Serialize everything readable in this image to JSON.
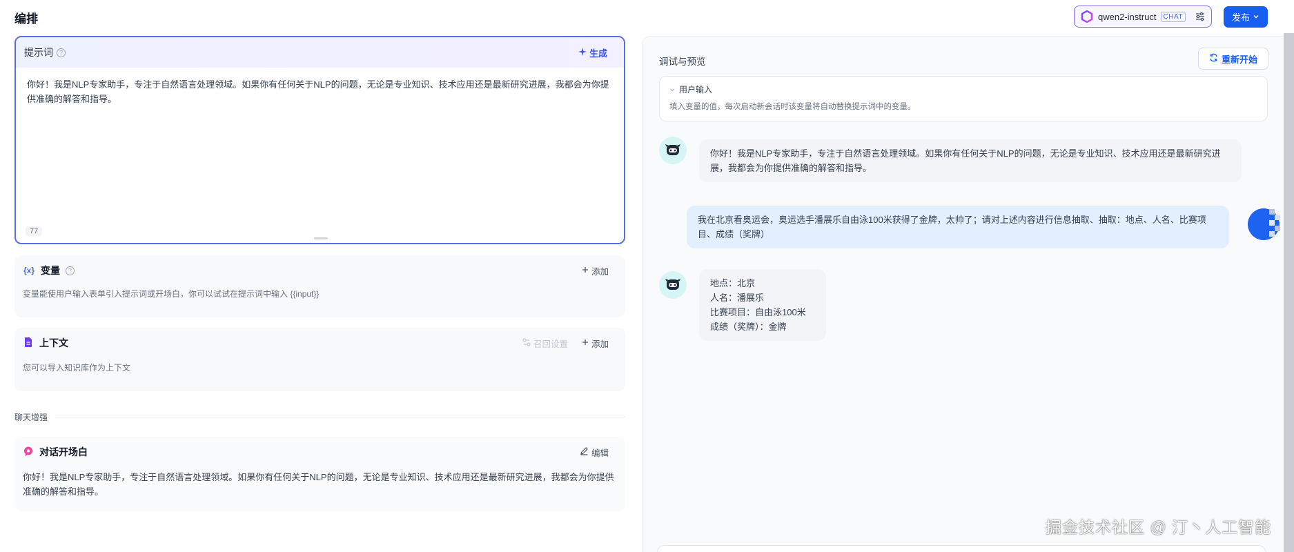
{
  "header": {
    "page_title": "编排",
    "model_name": "qwen2-instruct",
    "model_badge": "CHAT",
    "publish_label": "发布"
  },
  "prompt": {
    "title": "提示词",
    "generate_label": "生成",
    "text": "你好！我是NLP专家助手，专注于自然语言处理领域。如果你有任何关于NLP的问题，无论是专业知识、技术应用还是最新研究进展，我都会为你提供准确的解答和指导。",
    "char_count": "77"
  },
  "variables": {
    "title": "变量",
    "add_label": "添加",
    "description": "变量能使用户输入表单引入提示词或开场白，你可以试试在提示词中输入 {{input}}"
  },
  "context": {
    "title": "上下文",
    "recall_label": "召回设置",
    "add_label": "添加",
    "description": "您可以导入知识库作为上下文"
  },
  "chat_enhance": {
    "section_label": "聊天增强",
    "opener_title": "对话开场白",
    "edit_label": "编辑",
    "opener_text": "你好！我是NLP专家助手，专注于自然语言处理领域。如果你有任何关于NLP的问题，无论是专业知识、技术应用还是最新研究进展，我都会为你提供准确的解答和指导。"
  },
  "debug": {
    "title": "调试与预览",
    "restart_label": "重新开始",
    "user_input_title": "用户输入",
    "user_input_desc": "填入变量的值，每次启动新会话时该变量将自动替换提示词中的变量。"
  },
  "messages": {
    "bot_1": "你好！我是NLP专家助手，专注于自然语言处理领域。如果你有任何关于NLP的问题，无论是专业知识、技术应用还是最新研究进展，我都会为你提供准确的解答和指导。",
    "user_1": "我在北京看奥运会，奥运选手潘展乐自由泳100米获得了金牌，太帅了；请对上述内容进行信息抽取、抽取：地点、人名、比赛项目、成绩（奖牌）",
    "bot_2_line1": "地点：北京",
    "bot_2_line2": "人名：潘展乐",
    "bot_2_line3": "比赛项目：自由泳100米",
    "bot_2_line4": "成绩（奖牌）：金牌"
  },
  "watermark": "掘金技术社区 @ 汀丶人工智能",
  "colors": {
    "primary": "#155eef",
    "prompt_border": "#5a6de6",
    "avatar_bg": "#d5f5f6",
    "user_bubble": "#e1effe",
    "bot_bubble": "#f2f4f7"
  }
}
